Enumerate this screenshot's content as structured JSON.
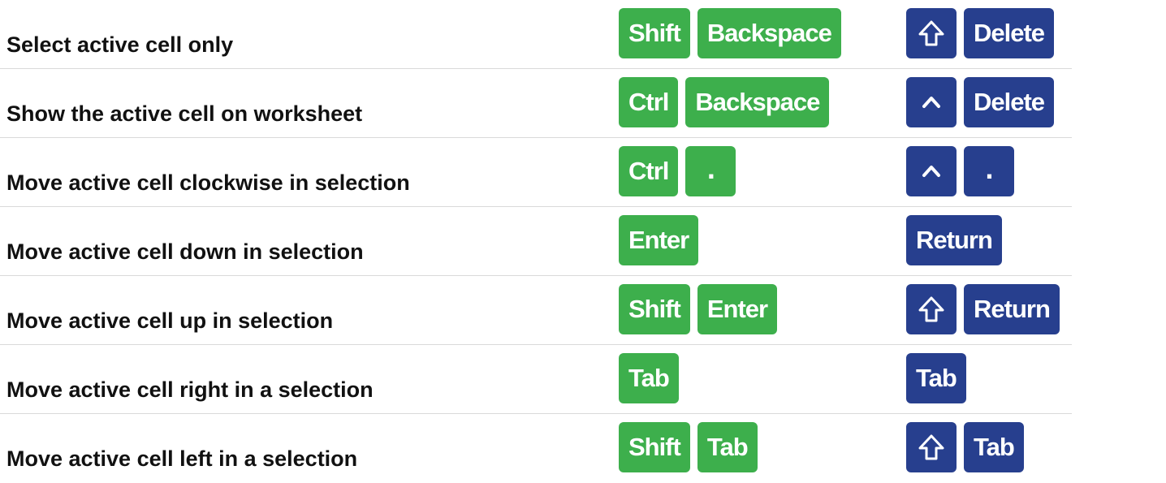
{
  "theme": {
    "windows_key_color": "#3daf4c",
    "mac_key_color": "#273f8e"
  },
  "shortcuts": [
    {
      "description": "Select active cell only",
      "windows": [
        {
          "label": "Shift"
        },
        {
          "label": "Backspace"
        }
      ],
      "mac": [
        {
          "icon": "shift-arrow-icon"
        },
        {
          "label": "Delete"
        }
      ]
    },
    {
      "description": "Show the active cell on worksheet",
      "windows": [
        {
          "label": "Ctrl"
        },
        {
          "label": "Backspace"
        }
      ],
      "mac": [
        {
          "icon": "control-caret-icon"
        },
        {
          "label": "Delete"
        }
      ]
    },
    {
      "description": "Move active cell clockwise in selection",
      "windows": [
        {
          "label": "Ctrl"
        },
        {
          "label": "."
        }
      ],
      "mac": [
        {
          "icon": "control-caret-icon"
        },
        {
          "label": "."
        }
      ]
    },
    {
      "description": "Move active cell down in selection",
      "windows": [
        {
          "label": "Enter"
        }
      ],
      "mac": [
        {
          "label": "Return"
        }
      ]
    },
    {
      "description": "Move active cell up in selection",
      "windows": [
        {
          "label": "Shift"
        },
        {
          "label": "Enter"
        }
      ],
      "mac": [
        {
          "icon": "shift-arrow-icon"
        },
        {
          "label": "Return"
        }
      ]
    },
    {
      "description": "Move active cell right in a selection",
      "windows": [
        {
          "label": "Tab"
        }
      ],
      "mac": [
        {
          "label": "Tab"
        }
      ]
    },
    {
      "description": "Move active cell left in a selection",
      "windows": [
        {
          "label": "Shift"
        },
        {
          "label": "Tab"
        }
      ],
      "mac": [
        {
          "icon": "shift-arrow-icon"
        },
        {
          "label": "Tab"
        }
      ]
    }
  ]
}
